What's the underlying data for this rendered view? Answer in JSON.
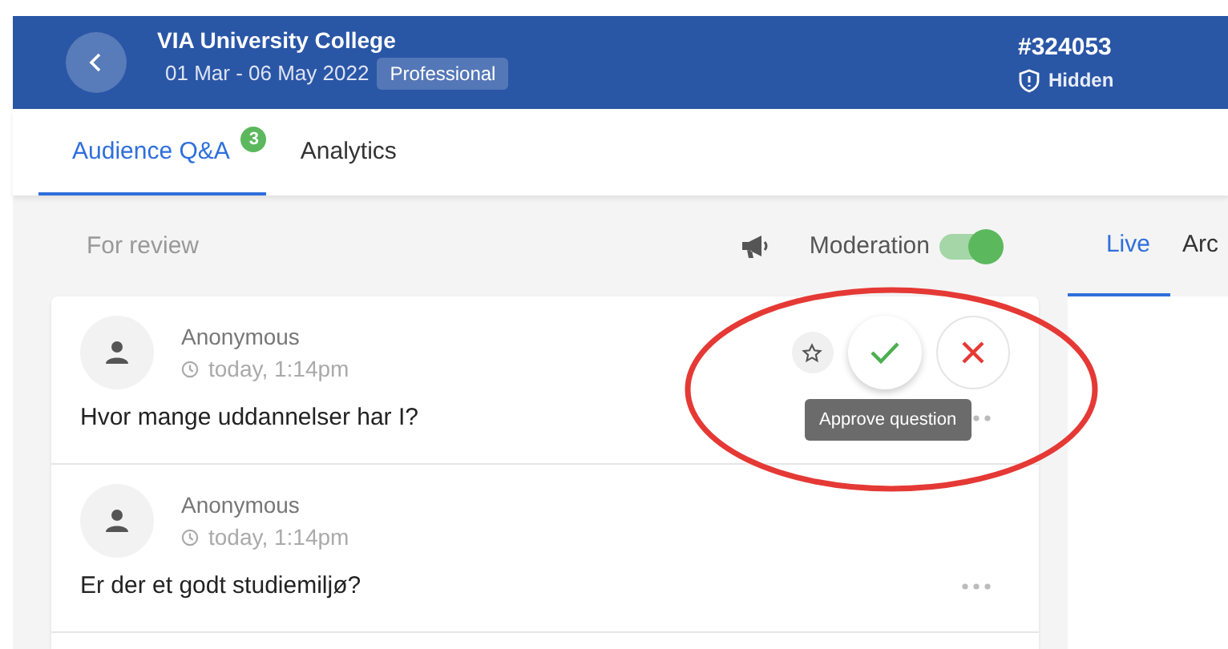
{
  "header": {
    "title": "VIA University College",
    "dates": "01 Mar - 06 May 2022",
    "plan": "Professional",
    "event_code": "#324053",
    "visibility": "Hidden"
  },
  "tabs": [
    {
      "label": "Audience Q&A",
      "selected": true,
      "badge": "3"
    },
    {
      "label": "Analytics",
      "selected": false
    }
  ],
  "toolbar": {
    "filter": "For review",
    "moderation": {
      "label": "Moderation",
      "on": true
    }
  },
  "side_tabs": [
    {
      "label": "Live",
      "selected": true
    },
    {
      "label": "Arc",
      "selected": false
    }
  ],
  "questions": [
    {
      "author": "Anonymous",
      "time": "today, 1:14pm",
      "text": "Hvor mange uddannelser har I?",
      "show_actions": true,
      "tooltip": "Approve question"
    },
    {
      "author": "Anonymous",
      "time": "today, 1:14pm",
      "text": "Er der et godt studiemiljø?",
      "show_actions": false
    }
  ]
}
